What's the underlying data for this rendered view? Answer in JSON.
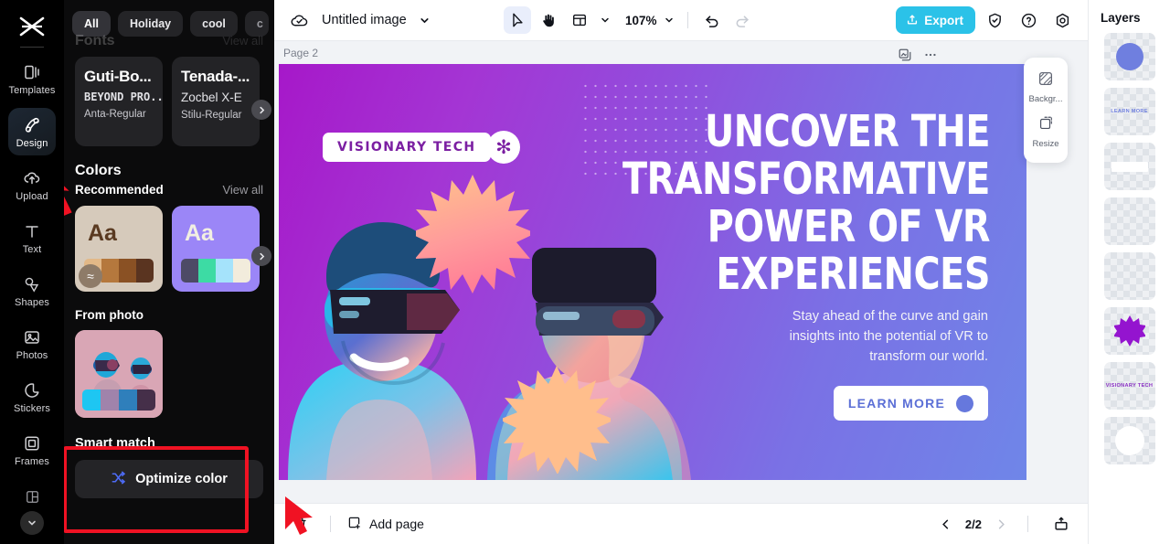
{
  "rail": {
    "logo_icon": "capcut-logo-icon",
    "items": [
      {
        "label": "Templates",
        "icon": "templates-icon",
        "active": false
      },
      {
        "label": "Design",
        "icon": "design-icon",
        "active": true
      },
      {
        "label": "Upload",
        "icon": "upload-icon",
        "active": false
      },
      {
        "label": "Text",
        "icon": "text-icon",
        "active": false
      },
      {
        "label": "Shapes",
        "icon": "shapes-icon",
        "active": false
      },
      {
        "label": "Photos",
        "icon": "photos-icon",
        "active": false
      },
      {
        "label": "Stickers",
        "icon": "stickers-icon",
        "active": false
      },
      {
        "label": "Frames",
        "icon": "frames-icon",
        "active": false
      }
    ],
    "more_icon": "chevron-down-icon",
    "more_tool_icon": "layout-icon"
  },
  "panel": {
    "chips": [
      {
        "label": "All",
        "selected": true
      },
      {
        "label": "Holiday",
        "selected": false
      },
      {
        "label": "cool",
        "selected": false
      },
      {
        "label": "c",
        "selected": false,
        "clipped": true
      }
    ],
    "chips_caret_icon": "chevron-down-icon",
    "fonts": {
      "title": "Fonts",
      "view_all": "View all",
      "cards": [
        {
          "line1": "Guti-Bo...",
          "line2": "BEYOND PRO...",
          "line3": "Anta-Regular"
        },
        {
          "line1": "Tenada-...",
          "line2": "Zocbel X-E",
          "line3": "Stilu-Regular"
        }
      ],
      "next_icon": "chevron-right-icon"
    },
    "colors": {
      "title": "Colors",
      "recommended_label": "Recommended",
      "view_all": "View all",
      "next_icon": "chevron-right-icon",
      "palettes": [
        {
          "sample_text": "Aa",
          "bg": "#d6cabb",
          "text_color": "#5a3a21",
          "swatches": [
            "#e2b887",
            "#b5783d",
            "#8a5124",
            "#5a3420"
          ],
          "badge_icon": "wave-icon",
          "badge_bg": "#8e7b68"
        },
        {
          "sample_text": "Aa",
          "bg": "#9b86f7",
          "text_color": "#f2efe2",
          "swatches": [
            "#4d4a66",
            "#3ddba4",
            "#a5e3fb",
            "#f2ecdc"
          ]
        }
      ]
    },
    "from_photo": {
      "title": "From photo",
      "bg": "#d9a6b5",
      "swatches": [
        "#1ec6f2",
        "#a083ab",
        "#2f7fbb",
        "#452f49"
      ]
    },
    "smart_match": {
      "title": "Smart match",
      "button_label": "Optimize color",
      "button_icon": "shuffle-icon"
    }
  },
  "topbar": {
    "cloud_icon": "cloud-saved-icon",
    "doc_title": "Untitled image",
    "doc_caret_icon": "chevron-down-icon",
    "tools": [
      {
        "icon": "cursor-select-icon",
        "active": true
      },
      {
        "icon": "hand-pan-icon",
        "active": false
      },
      {
        "icon": "layout-grid-icon",
        "active": false
      }
    ],
    "layout_caret_icon": "chevron-down-icon",
    "zoom": "107%",
    "zoom_caret_icon": "chevron-down-icon",
    "undo_icon": "undo-icon",
    "redo_icon": "redo-icon",
    "export_label": "Export",
    "export_icon": "export-upload-icon",
    "export_color": "#2bc2e8",
    "right_icons": [
      {
        "icon": "shield-check-icon"
      },
      {
        "icon": "help-question-icon"
      },
      {
        "icon": "settings-gear-icon"
      }
    ]
  },
  "stage": {
    "page_label": "Page 2",
    "tools": [
      {
        "icon": "duplicate-page-icon"
      },
      {
        "icon": "more-options-icon"
      }
    ],
    "float_panel": [
      {
        "label": "Backgr...",
        "icon": "background-icon"
      },
      {
        "label": "Resize",
        "icon": "resize-icon"
      }
    ]
  },
  "design": {
    "badge_text": "VISIONARY TECH",
    "badge_icon": "asterisk-icon",
    "headline": "UNCOVER THE TRANSFORMATIVE POWER OF VR EXPERIENCES",
    "subcopy": "Stay ahead of the curve and gain insights into the potential of VR to transform our world.",
    "cta_label": "LEARN MORE",
    "accent_purple": "#7b1fa2",
    "accent_blue": "#5b6fd6"
  },
  "bottombar": {
    "delete_icon": "trash-icon",
    "add_page_label": "Add page",
    "add_page_icon": "add-page-icon",
    "prev_icon": "chevron-left-icon",
    "next_icon": "chevron-right-icon",
    "page_count": "2/2",
    "present_icon": "present-icon"
  },
  "layers": {
    "title": "Layers",
    "items": [
      {
        "kind": "circle",
        "label": "",
        "color": "#6f7fdf"
      },
      {
        "kind": "text",
        "label": "LEARN MORE",
        "color": "#6f7fdf"
      },
      {
        "kind": "bar",
        "label": "",
        "color": "#ffffff"
      },
      {
        "kind": "empty",
        "label": "",
        "color": ""
      },
      {
        "kind": "empty",
        "label": "",
        "color": ""
      },
      {
        "kind": "burst",
        "label": "",
        "color": "#9414cf"
      },
      {
        "kind": "text",
        "label": "VISIONARY TECH",
        "color": "#8a2fc4"
      },
      {
        "kind": "circle",
        "label": "",
        "color": "#ffffff"
      }
    ]
  }
}
